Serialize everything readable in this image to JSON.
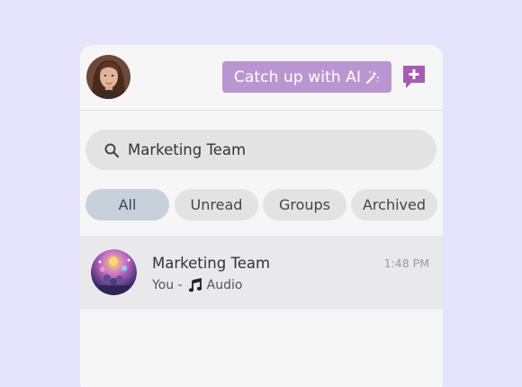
{
  "header": {
    "ai_button_label": "Catch up with AI",
    "ai_icon": "magic-wand-icon",
    "new_chat_icon": "new-chat-icon",
    "accent_color": "#b996d1"
  },
  "search": {
    "value": "Marketing Team",
    "icon": "search-icon"
  },
  "filters": [
    {
      "label": "All",
      "active": true
    },
    {
      "label": "Unread",
      "active": false
    },
    {
      "label": "Groups",
      "active": false
    },
    {
      "label": "Archived",
      "active": false
    }
  ],
  "chats": [
    {
      "name": "Marketing Team",
      "time": "1:48 PM",
      "sender": "You -",
      "message_icon": "music-note-icon",
      "message": "Audio"
    }
  ]
}
